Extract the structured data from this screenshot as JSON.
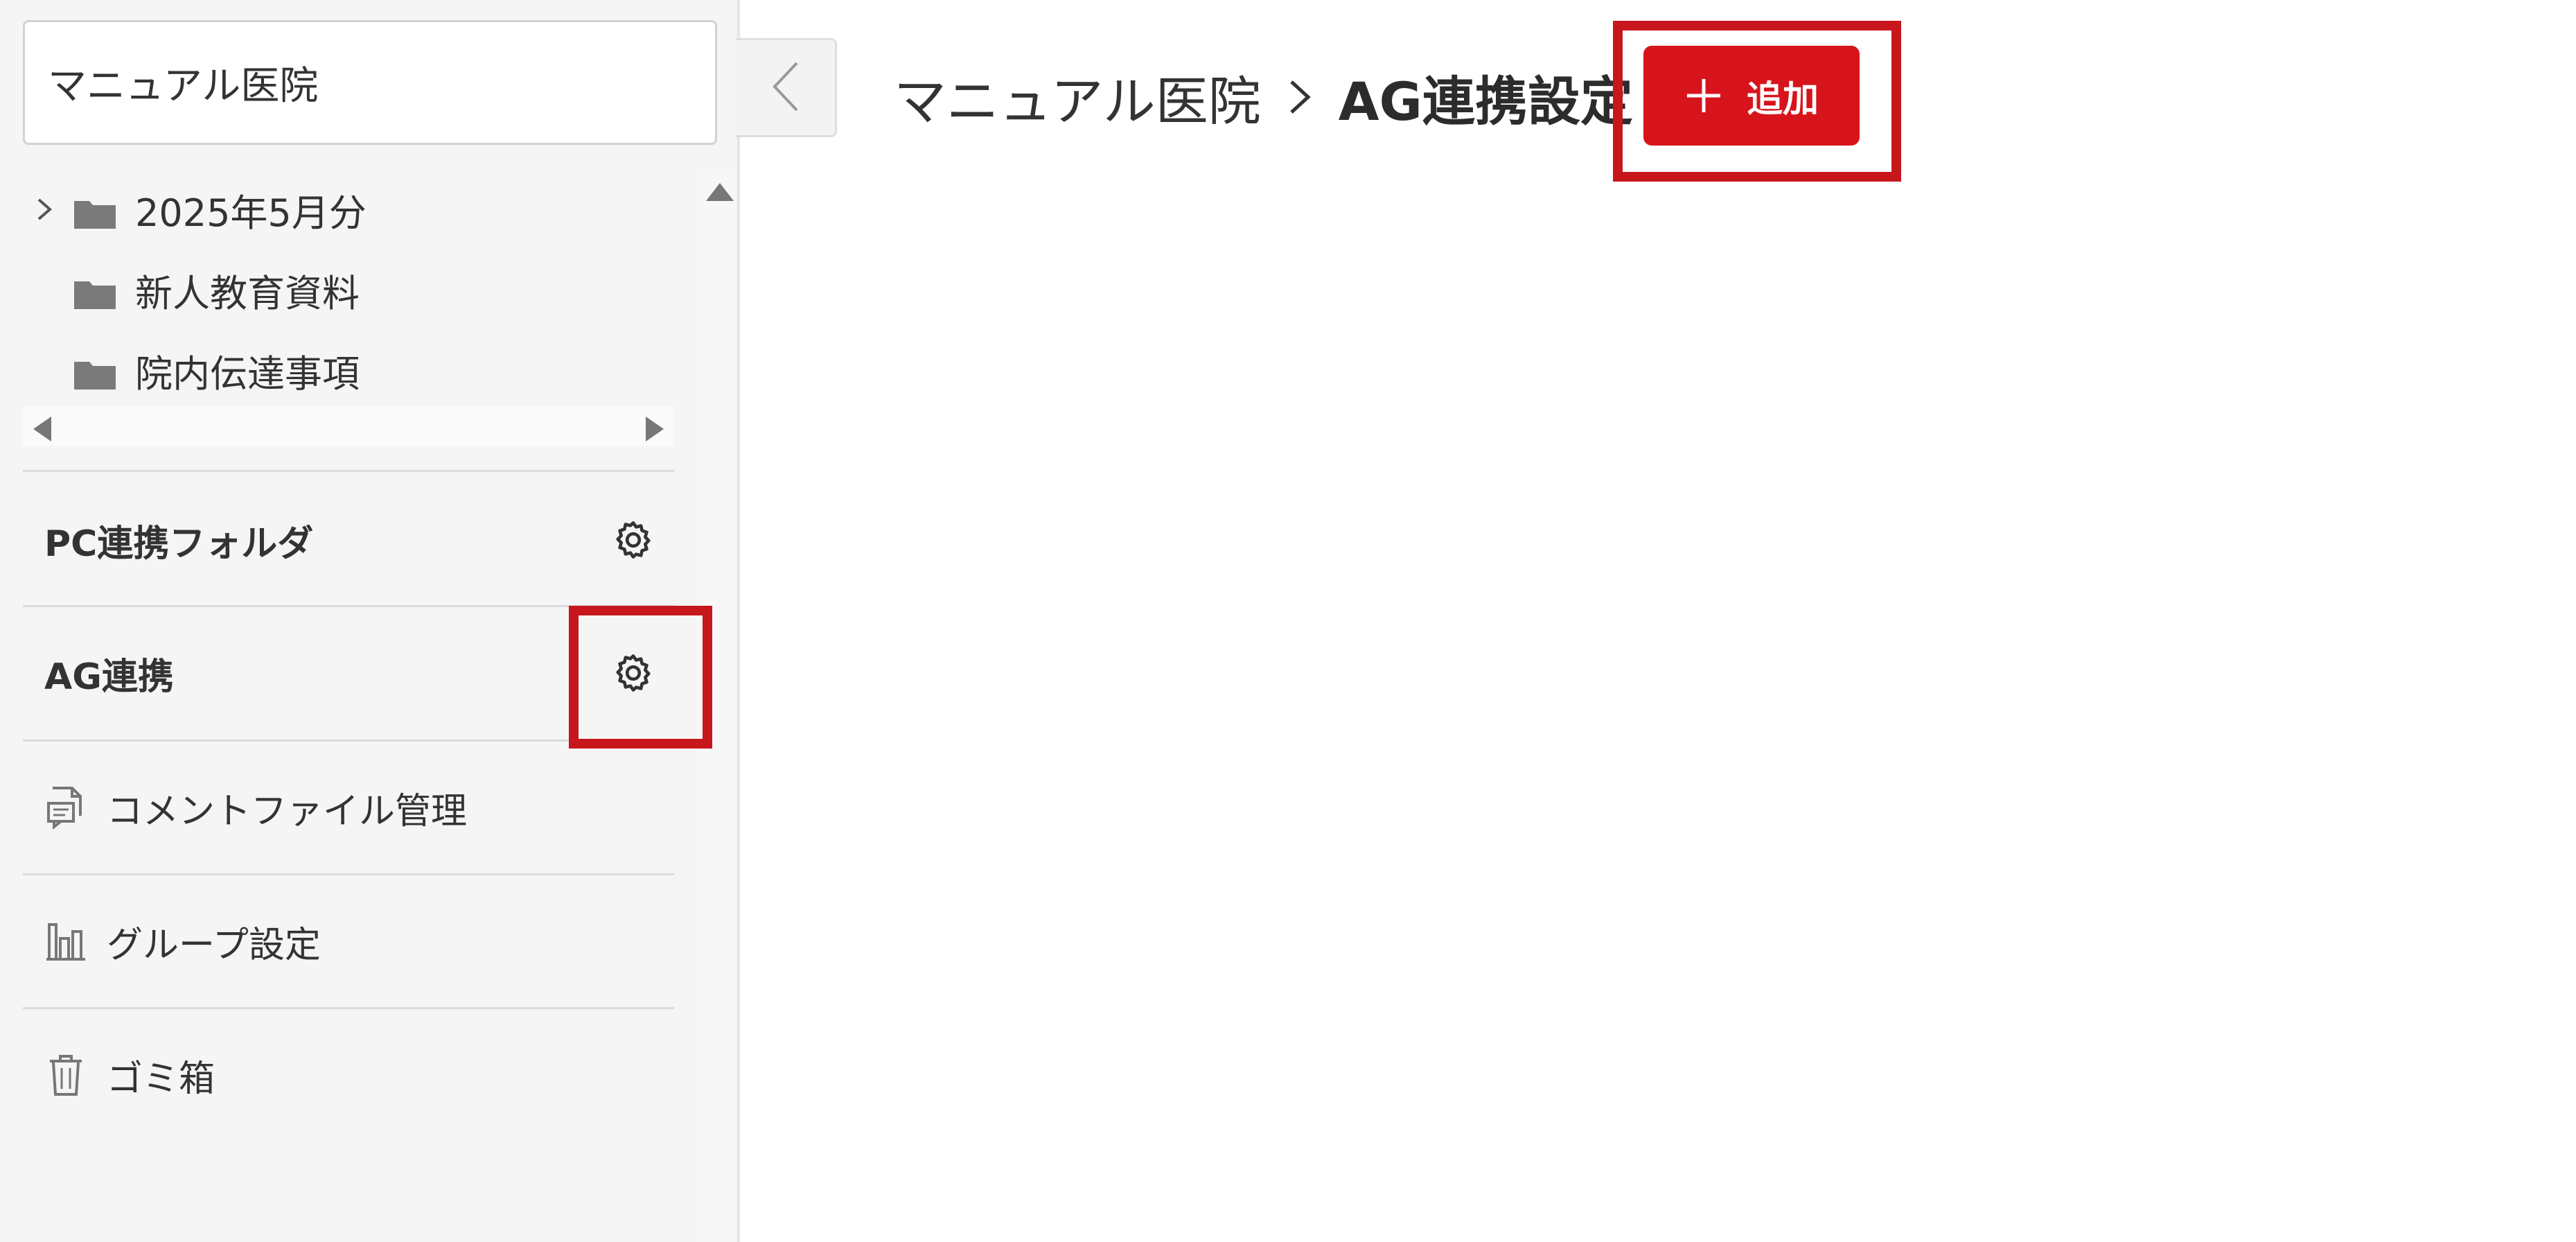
{
  "sidebar": {
    "search_value": "マニュアル医院",
    "tree": [
      {
        "label": "2025年5月分",
        "expandable": true
      },
      {
        "label": "新人教育資料",
        "expandable": false
      },
      {
        "label": "院内伝達事項",
        "expandable": false
      }
    ],
    "sections": [
      {
        "label": "PC連携フォルダ",
        "icon": "gear-icon"
      },
      {
        "label": "AG連携",
        "icon": "gear-icon"
      }
    ],
    "menu": [
      {
        "label": "コメントファイル管理",
        "icon": "comment-file-icon"
      },
      {
        "label": "グループ設定",
        "icon": "group-icon"
      },
      {
        "label": "ゴミ箱",
        "icon": "trash-icon"
      }
    ]
  },
  "header": {
    "breadcrumb_root": "マニュアル医院",
    "breadcrumb_current": "AG連携設定",
    "add_label": "追加"
  },
  "colors": {
    "accent": "#d7141b",
    "highlight": "#c8161d",
    "sidebar_bg": "#f5f5f5"
  }
}
